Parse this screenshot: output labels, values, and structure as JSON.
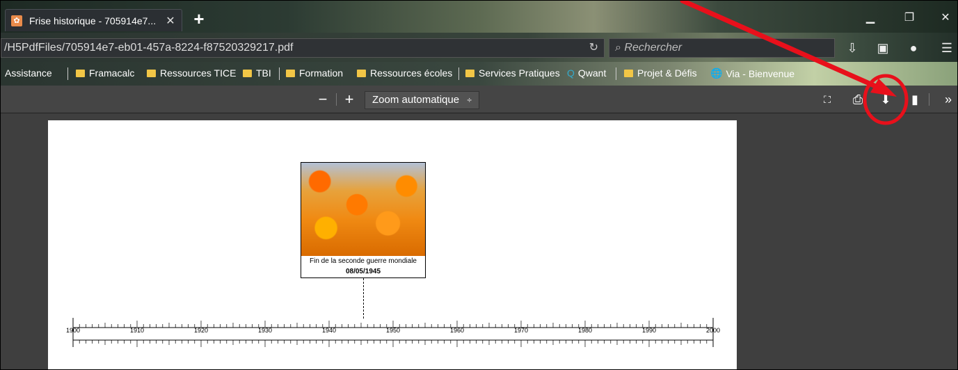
{
  "browser": {
    "tab_title": "Frise historique - 705914e7...",
    "tab_close": "✕",
    "new_tab": "+",
    "url": "/H5PdfFiles/705914e7-eb01-457a-8224-f87520329217.pdf",
    "reload_icon": "reload-icon",
    "search_placeholder": "Rechercher"
  },
  "bookmarks": [
    {
      "label": "Assistance",
      "folder": false
    },
    {
      "label": "Framacalc",
      "folder": true
    },
    {
      "label": "Ressources TICE",
      "folder": true
    },
    {
      "label": "TBI",
      "folder": true
    },
    {
      "label": "Formation",
      "folder": true
    },
    {
      "label": "Ressources écoles",
      "folder": true
    },
    {
      "label": "Services Pratiques",
      "folder": true
    },
    {
      "label": "Qwant",
      "folder": false
    },
    {
      "label": "Projet & Défis",
      "folder": true
    },
    {
      "label": "Via - Bienvenue",
      "folder": false
    }
  ],
  "pdf_toolbar": {
    "zoom_out": "−",
    "zoom_in": "+",
    "zoom_select": "Zoom automatique",
    "zoom_arrow": "÷"
  },
  "timeline": {
    "event_title": "Fin de la seconde guerre mondiale",
    "event_date": "08/05/1945",
    "axis_labels": [
      "1900",
      "1910",
      "1920",
      "1930",
      "1940",
      "1950",
      "1960",
      "1970",
      "1980",
      "1990",
      "2000"
    ]
  },
  "colors": {
    "annotation": "#e8101b"
  }
}
